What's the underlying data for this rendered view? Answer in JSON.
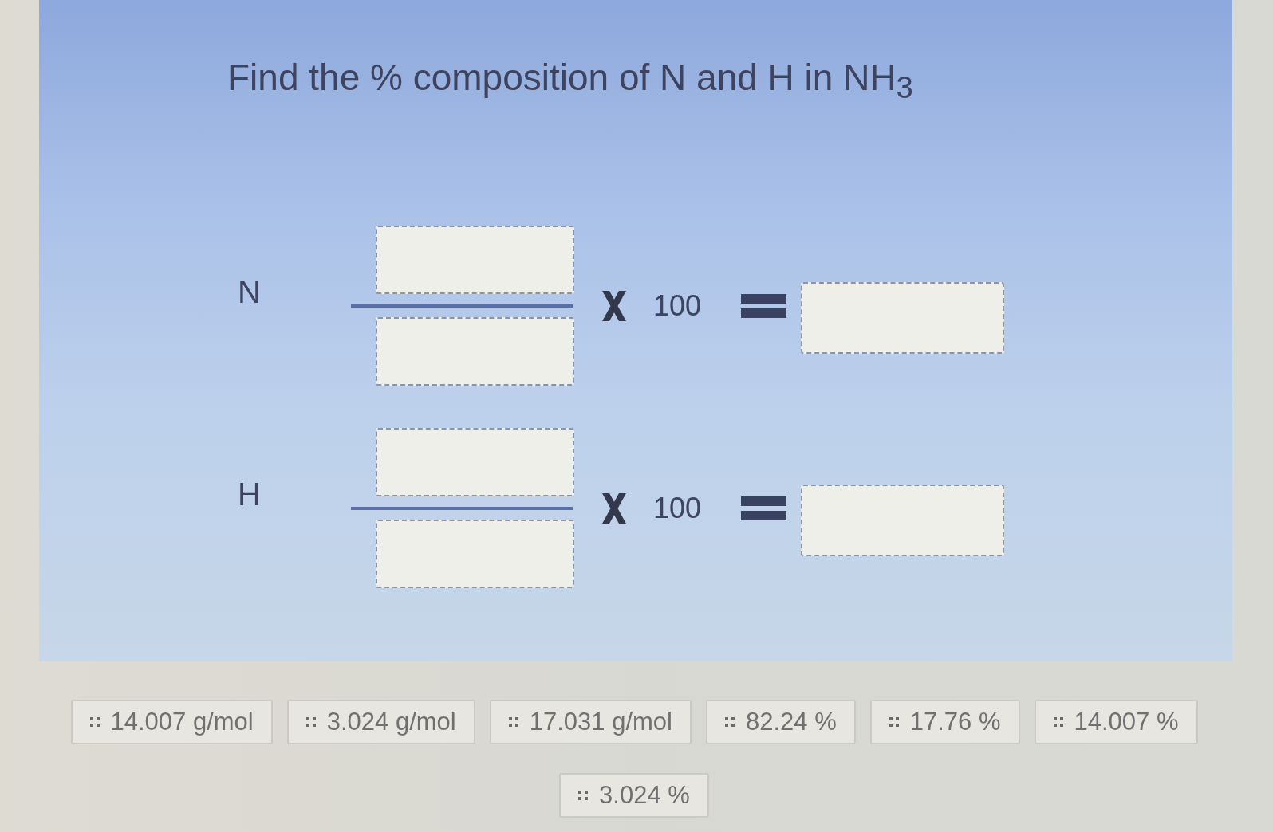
{
  "question": "Find the % composition of N and H in NH$_{3}$",
  "equations": [
    {
      "element": "N",
      "factor": "100"
    },
    {
      "element": "H",
      "factor": "100"
    }
  ],
  "answer_choices": [
    "14.007 g/mol",
    "3.024 g/mol",
    "17.031 g/mol",
    "82.24 %",
    "17.76 %",
    "14.007 %",
    "3.024 %"
  ]
}
